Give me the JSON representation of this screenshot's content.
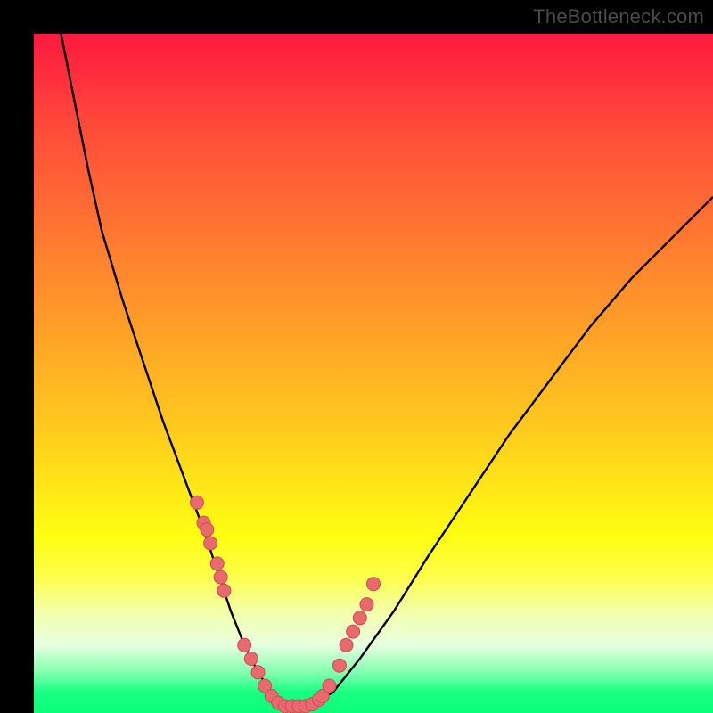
{
  "watermark": "TheBottleneck.com",
  "colors": {
    "background": "#000000",
    "curve": "#000000",
    "dot_fill": "#e86a6f",
    "dot_stroke": "#c94e55",
    "gradient_top": "#ff193f",
    "gradient_bottom": "#0aff78"
  },
  "chart_data": {
    "type": "line",
    "title": "",
    "xlabel": "",
    "ylabel": "",
    "xlim": [
      0,
      100
    ],
    "ylim": [
      0,
      100
    ],
    "note": "Axes unlabeled in source image; x/y normalized to 0–100. y is percent height from bottom.",
    "series": [
      {
        "name": "bottleneck-curve",
        "x": [
          4,
          6,
          8,
          10,
          13,
          16,
          19,
          22,
          25,
          27,
          29,
          31,
          33,
          35,
          37,
          40,
          44,
          48,
          53,
          58,
          64,
          70,
          76,
          82,
          88,
          94,
          100
        ],
        "y": [
          100,
          90,
          80,
          71,
          61,
          52,
          43,
          35,
          27,
          21,
          15,
          10,
          6,
          3,
          1,
          1,
          3,
          8,
          15,
          23,
          32,
          41,
          49,
          57,
          64,
          70,
          76
        ]
      }
    ],
    "dots": {
      "name": "highlighted-points",
      "x": [
        24,
        25,
        25.5,
        26,
        27,
        27.5,
        28,
        31,
        32,
        33,
        34,
        35,
        36,
        37,
        38,
        39,
        40,
        41,
        42,
        42.5,
        43.5,
        45,
        46,
        47,
        48,
        49,
        50
      ],
      "y": [
        31,
        28,
        27,
        25,
        22,
        20,
        18,
        10,
        8,
        6,
        4,
        2.5,
        1.5,
        1,
        1,
        1,
        1,
        1.3,
        2,
        2.5,
        4,
        7,
        10,
        12,
        14,
        16,
        19
      ]
    }
  }
}
